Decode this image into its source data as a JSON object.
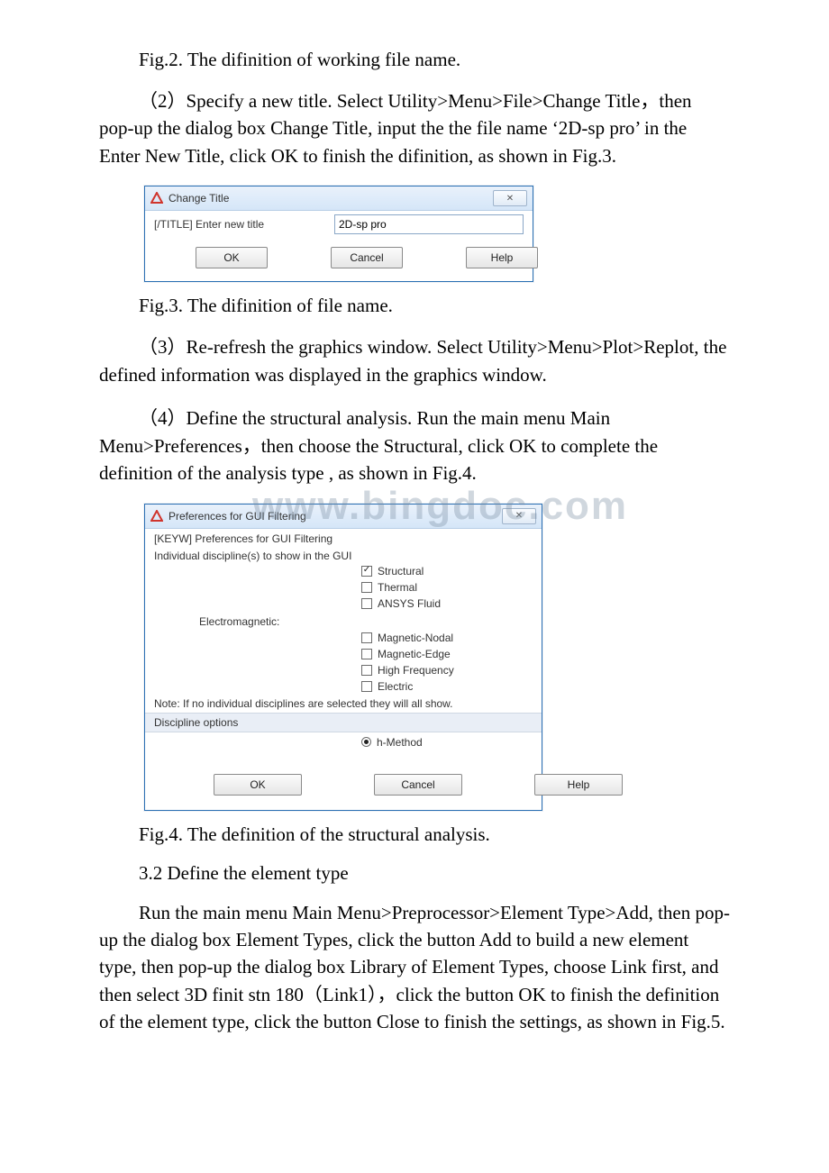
{
  "captions": {
    "fig2": "Fig.2. The difinition of working file name.",
    "fig3": "Fig.3. The difinition of file name.",
    "fig4": "Fig.4. The definition of the structural analysis."
  },
  "paragraphs": {
    "p2": "（2）Specify a new title. Select Utility>Menu>File>Change Title，then pop-up the dialog box Change Title, input the the file name ‘2D-sp pro’ in the Enter New Title, click OK to finish the difinition, as shown in Fig.3.",
    "p3": "（3）Re-refresh the graphics window. Select Utility>Menu>Plot>Replot, the defined information was displayed in the graphics window.",
    "p4": "（4）Define the structural analysis.  Run the main menu Main Menu>Preferences，then choose the Structural, click OK to complete the definition of the analysis type , as shown in Fig.4.",
    "p5": "Run the main menu Main Menu>Preprocessor>Element Type>Add, then pop-up the dialog box Element Types, click the button Add to build a new element type, then pop-up the dialog box Library of Element Types, choose Link first, and then select 3D finit stn 180（Link1），click the button OK to finish the definition of the element type, click the button Close to finish the settings, as shown in Fig.5."
  },
  "headings": {
    "h32": "3.2 Define the element type"
  },
  "change_title_dialog": {
    "window_title": "Change Title",
    "label": "[/TITLE]  Enter new title",
    "value": "2D-sp pro",
    "ok": "OK",
    "cancel": "Cancel",
    "help": "Help",
    "close_glyph": "✕"
  },
  "prefs_dialog": {
    "window_title": "Preferences for GUI Filtering",
    "line1": "[KEYW] Preferences for GUI Filtering",
    "line2": "Individual discipline(s) to show in the GUI",
    "electro_label": "Electromagnetic:",
    "items": {
      "structural": "Structural",
      "thermal": "Thermal",
      "ansys_fluid": "ANSYS Fluid",
      "mag_nodal": "Magnetic-Nodal",
      "mag_edge": "Magnetic-Edge",
      "high_freq": "High Frequency",
      "electric": "Electric"
    },
    "note": "Note: If no individual disciplines are selected they will all show.",
    "disc_options": "Discipline options",
    "hmethod": "h-Method",
    "ok": "OK",
    "cancel": "Cancel",
    "help": "Help",
    "close_glyph": "✕"
  },
  "watermark": "www.bingdoc.com"
}
